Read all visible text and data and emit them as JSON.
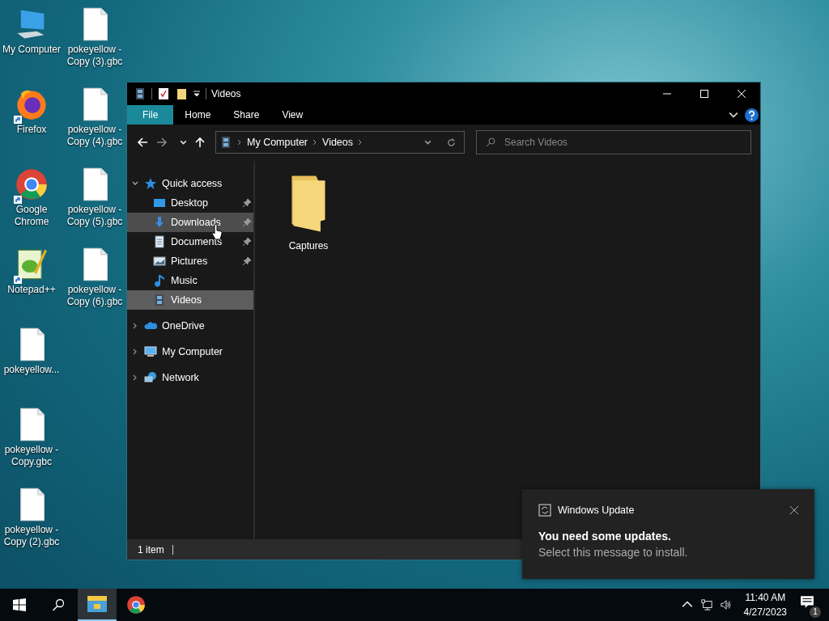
{
  "desktop": {
    "icons": [
      {
        "label": "My Computer",
        "kind": "computer",
        "shortcut": false
      },
      {
        "label": "Firefox",
        "kind": "firefox",
        "shortcut": true
      },
      {
        "label": "Google Chrome",
        "kind": "chrome",
        "shortcut": true
      },
      {
        "label": "Notepad++",
        "kind": "notepad",
        "shortcut": true
      },
      {
        "label": "pokeyellow...",
        "kind": "file",
        "shortcut": false
      },
      {
        "label": "pokeyellow - Copy.gbc",
        "kind": "file",
        "shortcut": false
      },
      {
        "label": "pokeyellow - Copy (2).gbc",
        "kind": "file",
        "shortcut": false
      },
      {
        "label": "pokeyellow - Copy (3).gbc",
        "kind": "file",
        "shortcut": false
      },
      {
        "label": "pokeyellow - Copy (4).gbc",
        "kind": "file",
        "shortcut": false
      },
      {
        "label": "pokeyellow - Copy (5).gbc",
        "kind": "file",
        "shortcut": false
      },
      {
        "label": "pokeyellow - Copy (6).gbc",
        "kind": "file",
        "shortcut": false
      }
    ]
  },
  "explorer": {
    "title": "Videos",
    "ribbon_tabs": [
      {
        "label": "File",
        "selected": true
      },
      {
        "label": "Home",
        "selected": false
      },
      {
        "label": "Share",
        "selected": false
      },
      {
        "label": "View",
        "selected": false
      }
    ],
    "address": {
      "path": [
        "My Computer",
        "Videos"
      ]
    },
    "search": {
      "placeholder": "Search Videos"
    },
    "nav": [
      {
        "label": "Quick access",
        "kind": "star",
        "expanded": true,
        "children": [
          {
            "label": "Desktop",
            "kind": "desktop",
            "pinned": true,
            "selected": false,
            "hovered": false
          },
          {
            "label": "Downloads",
            "kind": "download",
            "pinned": true,
            "selected": false,
            "hovered": true
          },
          {
            "label": "Documents",
            "kind": "document",
            "pinned": true,
            "selected": false,
            "hovered": false
          },
          {
            "label": "Pictures",
            "kind": "picture",
            "pinned": true,
            "selected": false,
            "hovered": false
          },
          {
            "label": "Music",
            "kind": "music",
            "pinned": false,
            "selected": false,
            "hovered": false
          },
          {
            "label": "Videos",
            "kind": "video",
            "pinned": false,
            "selected": true,
            "hovered": false
          }
        ]
      },
      {
        "label": "OneDrive",
        "kind": "cloud",
        "expanded": false
      },
      {
        "label": "My Computer",
        "kind": "computer",
        "expanded": false
      },
      {
        "label": "Network",
        "kind": "network",
        "expanded": false
      }
    ],
    "items": [
      {
        "label": "Captures",
        "kind": "folder"
      }
    ],
    "status_bar": {
      "count": "1 item"
    }
  },
  "notification": {
    "app": "Windows Update",
    "title": "You need some updates.",
    "message": "Select this message to install."
  },
  "taskbar": {
    "apps": [
      {
        "kind": "explorer",
        "selected": true
      },
      {
        "kind": "chrome",
        "selected": false
      }
    ],
    "time": "11:40 AM",
    "date": "4/27/2023",
    "notification_count": "1"
  }
}
